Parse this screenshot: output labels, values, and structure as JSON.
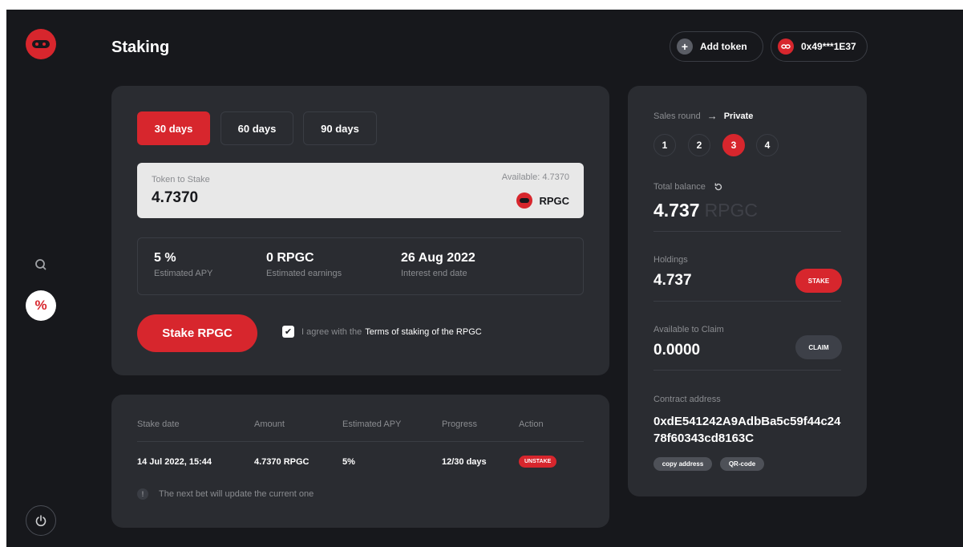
{
  "header": {
    "title": "Staking",
    "add_token_label": "Add token",
    "wallet_address": "0x49***1E37"
  },
  "tabs": [
    {
      "label": "30 days",
      "active": true
    },
    {
      "label": "60 days",
      "active": false
    },
    {
      "label": "90 days",
      "active": false
    }
  ],
  "stake_input": {
    "label": "Token to Stake",
    "value": "4.7370",
    "available": "Available: 4.7370",
    "token": "RPGC"
  },
  "stats": [
    {
      "value": "5 %",
      "label": "Estimated APY"
    },
    {
      "value": "0 RPGC",
      "label": "Estimated earnings"
    },
    {
      "value": "26 Aug 2022",
      "label": "Interest end date"
    }
  ],
  "stake_button": "Stake RPGC",
  "agree": {
    "text": "I agree with the",
    "link": "Terms of staking of the RPGC",
    "checked": true
  },
  "table": {
    "headers": [
      "Stake date",
      "Amount",
      "Estimated APY",
      "Progress",
      "Action"
    ],
    "rows": [
      {
        "date": "14 Jul 2022, 15:44",
        "amount": "4.7370 RPGC",
        "apy": "5%",
        "progress": "12/30 days",
        "action": "UNSTAKE"
      }
    ],
    "note": "The next bet will update the current one"
  },
  "right": {
    "sales_round_label": "Sales round",
    "sales_round_value": "Private",
    "rounds": [
      "1",
      "2",
      "3",
      "4"
    ],
    "active_round": "3",
    "total_balance_label": "Total balance",
    "total_balance_value": "4.737",
    "total_balance_unit": "RPGC",
    "holdings_label": "Holdings",
    "holdings_value": "4.737",
    "stake_label": "STAKE",
    "claim_available_label": "Available to Claim",
    "claim_available_value": "0.0000",
    "claim_label": "CLAIM",
    "contract_label": "Contract address",
    "contract_address": "0xdE541242A9AdbBa5c59f44c2478f60343cd8163C",
    "copy_label": "copy address",
    "qr_label": "QR-code"
  },
  "colors": {
    "accent": "#d7262d",
    "background": "#17181c",
    "card": "#2a2c31"
  }
}
